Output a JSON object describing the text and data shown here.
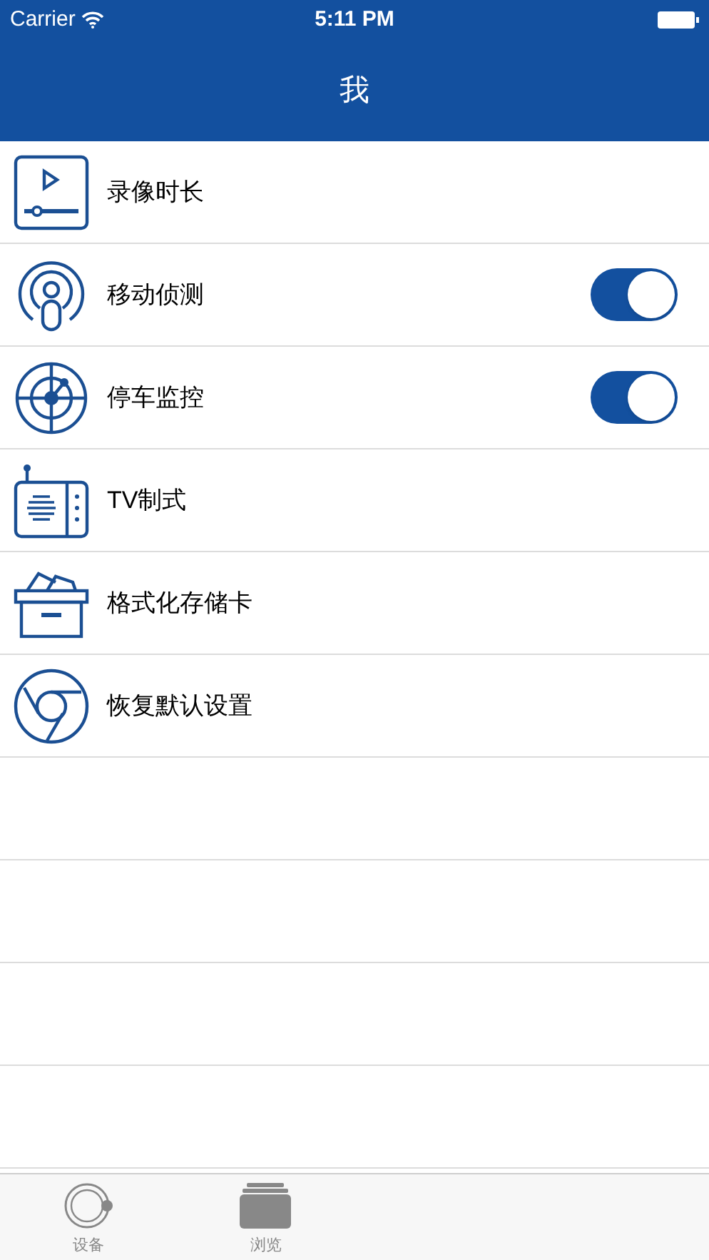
{
  "status_bar": {
    "carrier": "Carrier",
    "time": "5:11 PM"
  },
  "nav_bar": {
    "title": "我"
  },
  "settings": [
    {
      "label": "录像时长",
      "kind": "plain"
    },
    {
      "label": "移动侦测",
      "kind": "toggle",
      "on": true
    },
    {
      "label": "停车监控",
      "kind": "toggle",
      "on": true
    },
    {
      "label": "TV制式",
      "kind": "plain"
    },
    {
      "label": "格式化存储卡",
      "kind": "plain"
    },
    {
      "label": "恢复默认设置",
      "kind": "plain"
    }
  ],
  "tab_bar": [
    {
      "label": "设备",
      "selected": false
    },
    {
      "label": "浏览",
      "selected": false
    }
  ]
}
